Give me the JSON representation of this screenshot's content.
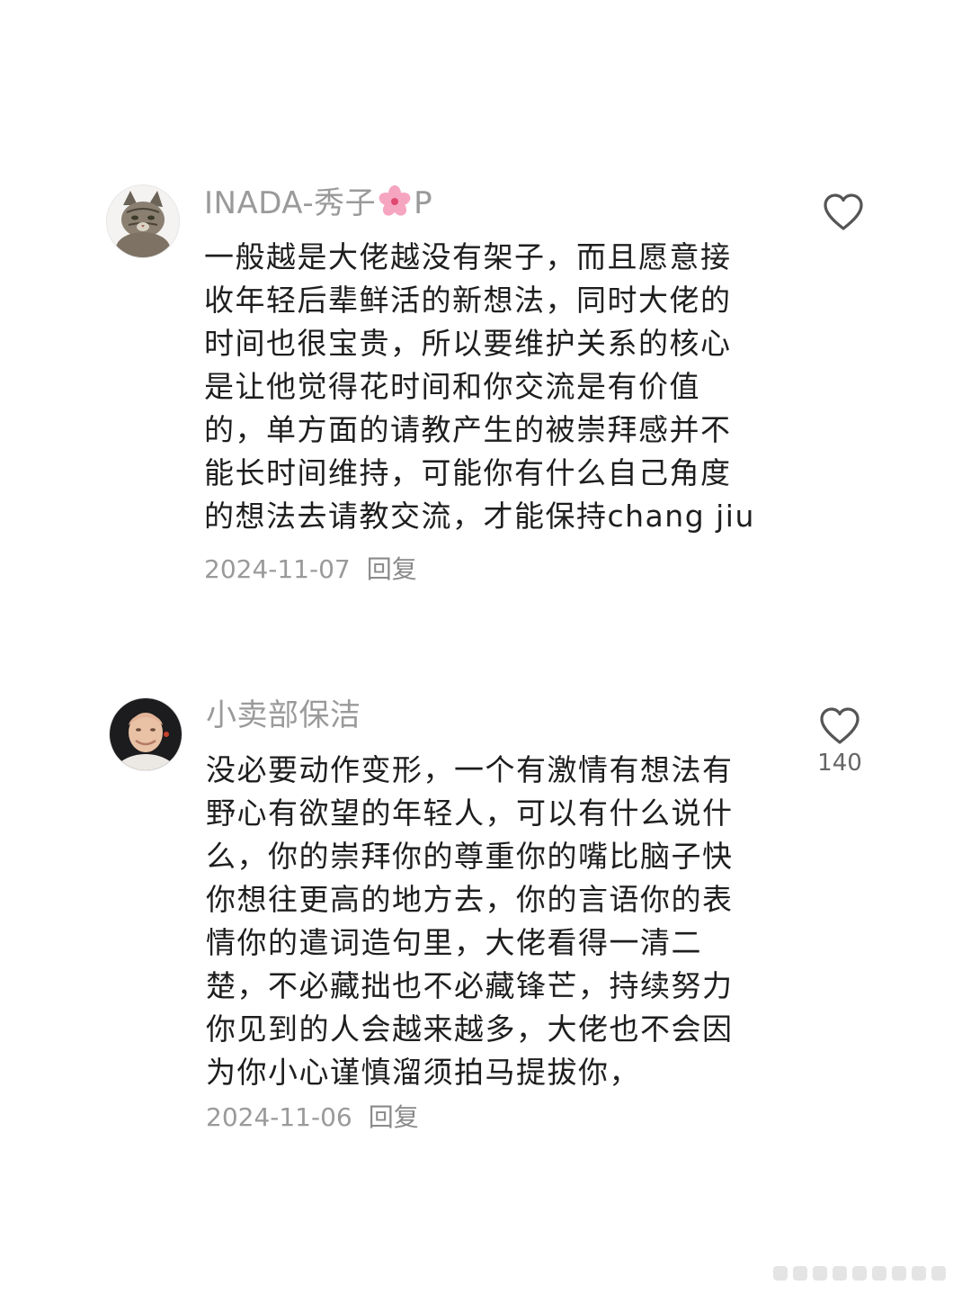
{
  "comments": [
    {
      "username": "INADA-秀子",
      "username_suffix": "P",
      "name_emoji": "cherry-blossom-icon",
      "avatar": "cat-avatar",
      "text": "一般越是大佬越没有架子，而且愿意接收年轻后辈鲜活的新想法，同时大佬的时间也很宝贵，所以要维护关系的核心是让他觉得花时间和你交流是有价值的，单方面的请教产生的被崇拜感并不能长时间维持，可能你有什么自己角度的想法去请教交流，才能保持chang jiu",
      "date": "2024-11-07",
      "reply_label": "回复",
      "like_icon": "heart-outline-icon"
    },
    {
      "username": "小卖部保洁",
      "avatar": "person-avatar",
      "text": "没必要动作变形，一个有激情有想法有野心有欲望的年轻人，可以有什么说什么，你的崇拜你的尊重你的嘴比脑子快你想往更高的地方去，你的言语你的表情你的遣词造句里，大佬看得一清二楚，不必藏拙也不必藏锋芒，持续努力你见到的人会越来越多，大佬也不会因为你小心谨慎溜须拍马提拔你，",
      "date": "2024-11-06",
      "reply_label": "回复",
      "like_icon": "heart-outline-icon",
      "like_count": "140"
    }
  ]
}
